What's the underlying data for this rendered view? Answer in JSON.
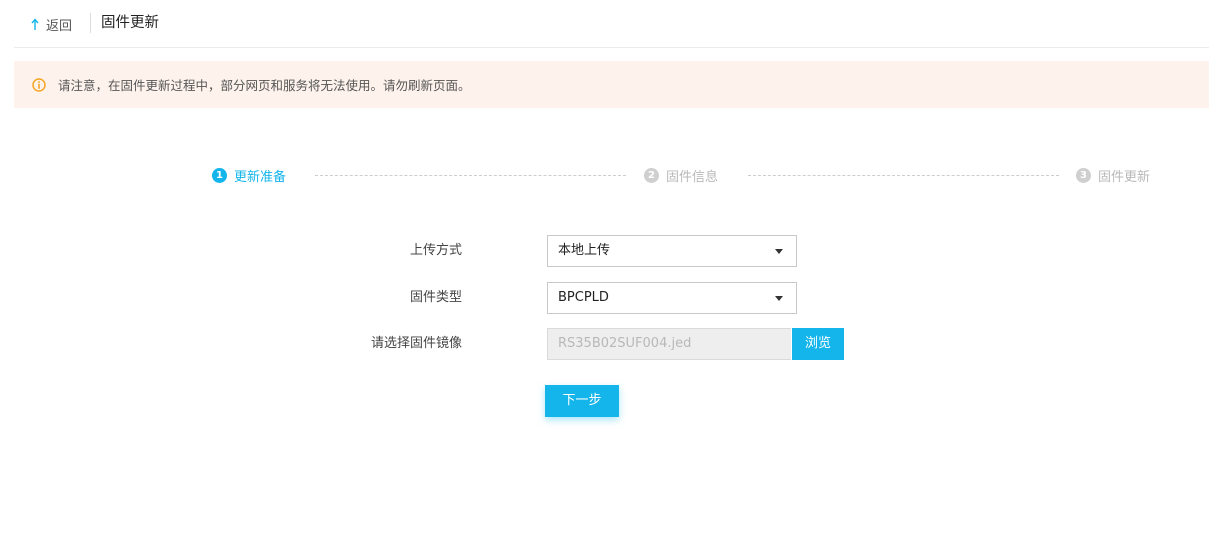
{
  "header": {
    "back_label": "返回",
    "title": "固件更新",
    "back_icon": "back-arrow-icon"
  },
  "notice": {
    "icon": "warning-icon",
    "text": "请注意，在固件更新过程中，部分网页和服务将无法使用。请勿刷新页面。",
    "color": "#f5a623",
    "background": "#fdf2ec"
  },
  "steps": [
    {
      "number": "1",
      "label": "更新准备",
      "state": "active"
    },
    {
      "number": "2",
      "label": "固件信息",
      "state": "inactive"
    },
    {
      "number": "3",
      "label": "固件更新",
      "state": "inactive"
    }
  ],
  "form": {
    "upload_method": {
      "label": "上传方式",
      "value": "本地上传"
    },
    "firmware_type": {
      "label": "固件类型",
      "value": "BPCPLD"
    },
    "firmware_image": {
      "label": "请选择固件镜像",
      "value": "RS35B02SUF004.jed",
      "browse_label": "浏览"
    },
    "next_label": "下一步"
  },
  "colors": {
    "accent": "#13b5ea",
    "inactive_step": "#cfcfcf"
  }
}
